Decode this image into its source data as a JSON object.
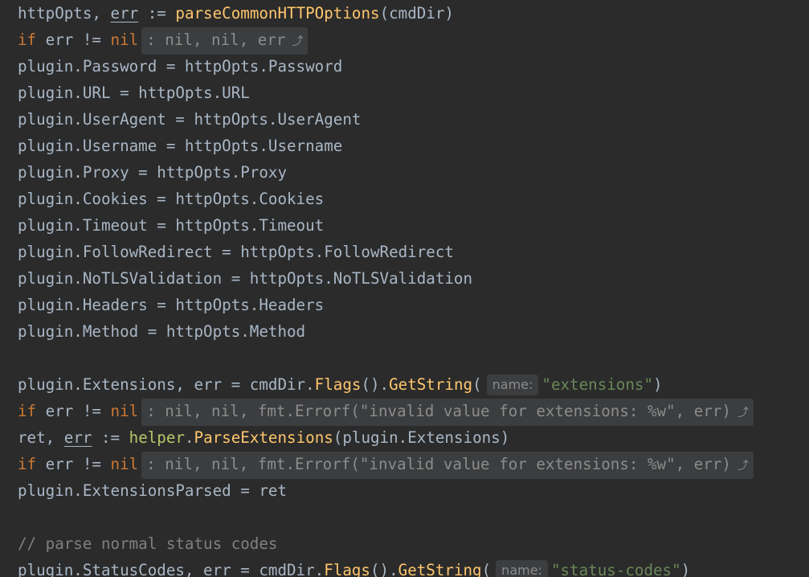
{
  "editor": {
    "lines": [
      {
        "tokens": [
          {
            "t": "httpOpts",
            "c": "default"
          },
          {
            "t": ", ",
            "c": "default"
          },
          {
            "t": "err",
            "c": "err"
          },
          {
            "t": " := ",
            "c": "default"
          },
          {
            "t": "parseCommonHTTPOptions",
            "c": "func"
          },
          {
            "t": "(cmdDir)",
            "c": "default"
          }
        ]
      },
      {
        "tokens": [
          {
            "t": "if",
            "c": "keyword"
          },
          {
            "t": " err != ",
            "c": "default"
          },
          {
            "t": "nil",
            "c": "keyword"
          }
        ],
        "fold": ": nil, nil, err"
      },
      {
        "tokens": [
          {
            "t": "plugin.Password = httpOpts.Password",
            "c": "default"
          }
        ]
      },
      {
        "tokens": [
          {
            "t": "plugin.URL = httpOpts.URL",
            "c": "default"
          }
        ]
      },
      {
        "tokens": [
          {
            "t": "plugin.UserAgent = httpOpts.UserAgent",
            "c": "default"
          }
        ]
      },
      {
        "tokens": [
          {
            "t": "plugin.Username = httpOpts.Username",
            "c": "default"
          }
        ]
      },
      {
        "tokens": [
          {
            "t": "plugin.Proxy = httpOpts.Proxy",
            "c": "default"
          }
        ]
      },
      {
        "tokens": [
          {
            "t": "plugin.Cookies = httpOpts.Cookies",
            "c": "default"
          }
        ]
      },
      {
        "tokens": [
          {
            "t": "plugin.Timeout = httpOpts.Timeout",
            "c": "default"
          }
        ]
      },
      {
        "tokens": [
          {
            "t": "plugin.FollowRedirect = httpOpts.FollowRedirect",
            "c": "default"
          }
        ]
      },
      {
        "tokens": [
          {
            "t": "plugin.NoTLSValidation = httpOpts.NoTLSValidation",
            "c": "default"
          }
        ]
      },
      {
        "tokens": [
          {
            "t": "plugin.Headers = httpOpts.Headers",
            "c": "default"
          }
        ]
      },
      {
        "tokens": [
          {
            "t": "plugin.Method = httpOpts.Method",
            "c": "default"
          }
        ]
      },
      {
        "tokens": []
      },
      {
        "tokens": [
          {
            "t": "plugin.Extensions, err = cmdDir.",
            "c": "default"
          },
          {
            "t": "Flags",
            "c": "func"
          },
          {
            "t": "().",
            "c": "default"
          },
          {
            "t": "GetString",
            "c": "func"
          },
          {
            "t": "(",
            "c": "default"
          },
          {
            "hint": "name:"
          },
          {
            "t": "\"extensions\"",
            "c": "string"
          },
          {
            "t": ")",
            "c": "default"
          }
        ]
      },
      {
        "tokens": [
          {
            "t": "if",
            "c": "keyword"
          },
          {
            "t": " err != ",
            "c": "default"
          },
          {
            "t": "nil",
            "c": "keyword"
          }
        ],
        "fold": ": nil, nil, fmt.Errorf(\"invalid value for extensions: %w\", err)"
      },
      {
        "tokens": [
          {
            "t": "ret",
            "c": "default"
          },
          {
            "t": ", ",
            "c": "default"
          },
          {
            "t": "err",
            "c": "err"
          },
          {
            "t": " := ",
            "c": "default"
          },
          {
            "t": "helper",
            "c": "pkg"
          },
          {
            "t": ".",
            "c": "default"
          },
          {
            "t": "ParseExtensions",
            "c": "func"
          },
          {
            "t": "(plugin.Extensions)",
            "c": "default"
          }
        ]
      },
      {
        "tokens": [
          {
            "t": "if",
            "c": "keyword"
          },
          {
            "t": " err != ",
            "c": "default"
          },
          {
            "t": "nil",
            "c": "keyword"
          }
        ],
        "fold": ": nil, nil, fmt.Errorf(\"invalid value for extensions: %w\", err)"
      },
      {
        "tokens": [
          {
            "t": "plugin.ExtensionsParsed = ret",
            "c": "default"
          }
        ]
      },
      {
        "tokens": []
      },
      {
        "tokens": [
          {
            "t": "// parse normal status codes",
            "c": "comment"
          }
        ]
      },
      {
        "tokens": [
          {
            "t": "plugin.StatusCodes, err = cmdDir.",
            "c": "default"
          },
          {
            "t": "Flags",
            "c": "func"
          },
          {
            "t": "().",
            "c": "default"
          },
          {
            "t": "GetString",
            "c": "func"
          },
          {
            "t": "(",
            "c": "default"
          },
          {
            "hint": "name:"
          },
          {
            "t": "\"status-codes\"",
            "c": "string"
          },
          {
            "t": ")",
            "c": "default"
          }
        ]
      }
    ],
    "fold_arrow_icon": "fold-expand-icon"
  }
}
